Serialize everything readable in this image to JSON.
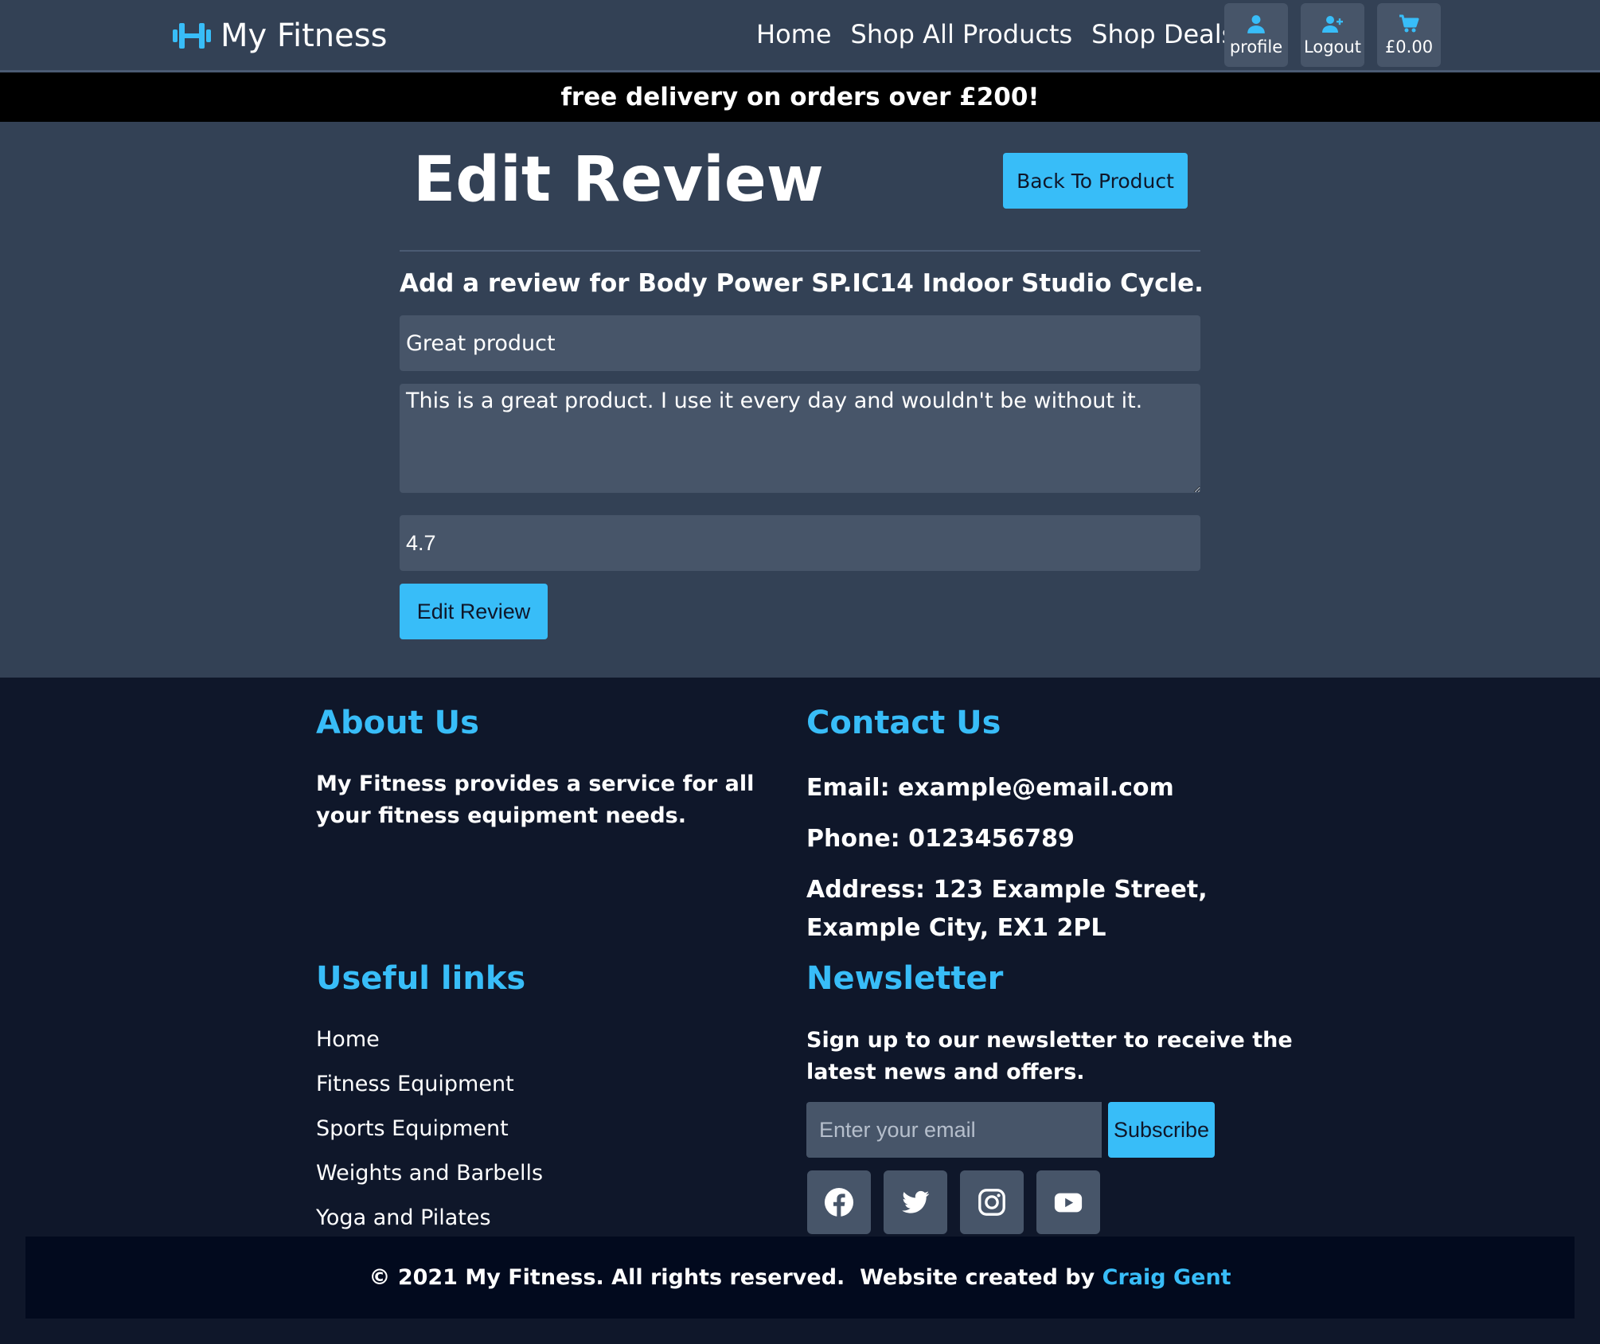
{
  "header": {
    "brand": "My Fitness",
    "nav": {
      "home": "Home",
      "shop_all": "Shop All Products",
      "shop_deals": "Shop Deals"
    },
    "buttons": {
      "profile": "profile",
      "logout": "Logout",
      "cart_total": "£0.00"
    }
  },
  "banner": {
    "text": "free delivery on orders over £200!"
  },
  "main": {
    "title": "Edit Review",
    "back_button": "Back To Product",
    "form_heading": "Add a review for Body Power SP.IC14 Indoor Studio Cycle.",
    "review_title": "Great product",
    "review_body": "This is a great product. I use it every day and wouldn't be without it.",
    "rating": "4.7",
    "submit_button": "Edit Review"
  },
  "footer": {
    "about": {
      "heading": "About Us",
      "text": "My Fitness provides a service for all your fitness equipment needs."
    },
    "contact": {
      "heading": "Contact Us",
      "email": "Email: example@email.com",
      "phone": "Phone: 0123456789",
      "address": "Address: 123 Example Street, Example City, EX1 2PL"
    },
    "useful_links": {
      "heading": "Useful links",
      "items": [
        "Home",
        "Fitness Equipment",
        "Sports Equipment",
        "Weights and Barbells",
        "Yoga and Pilates"
      ]
    },
    "newsletter": {
      "heading": "Newsletter",
      "text": "Sign up to our newsletter to receive the latest news and offers.",
      "email_placeholder": "Enter your email",
      "subscribe_button": "Subscribe"
    },
    "social_icons": [
      "facebook-icon",
      "twitter-icon",
      "instagram-icon",
      "youtube-icon"
    ],
    "copyright": "© 2021 My Fitness. All rights reserved.  Website created by ",
    "credit_name": "Craig Gent"
  },
  "colors": {
    "accent": "#38bdf8",
    "nav_bg": "#334155",
    "button_bg": "#475569",
    "footer_bg": "#0f172a",
    "banner_bg": "#000000"
  }
}
